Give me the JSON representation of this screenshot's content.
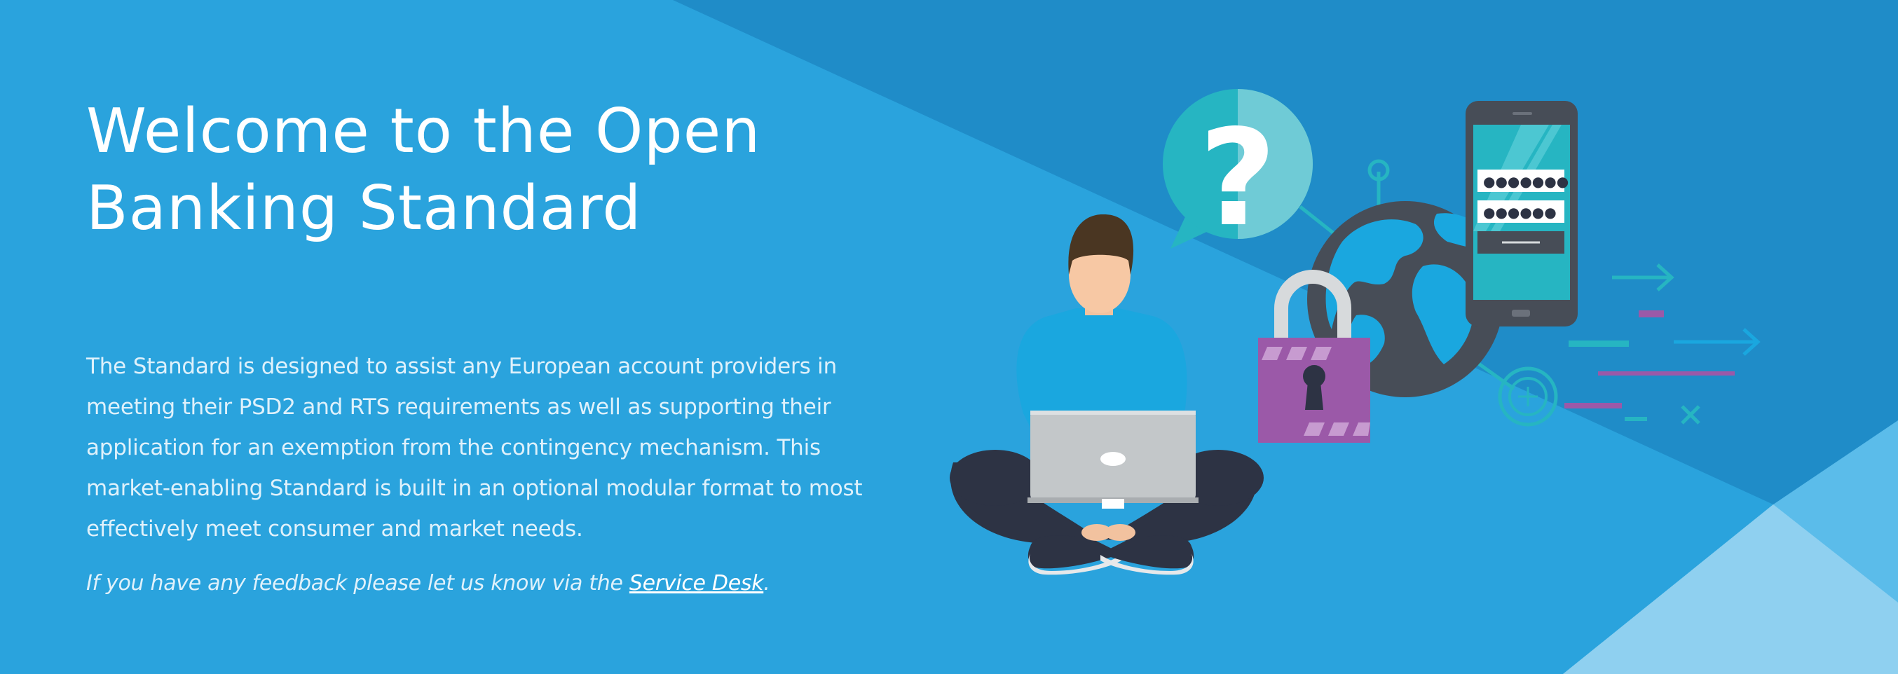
{
  "hero": {
    "title_line1": "Welcome to the Open",
    "title_line2": "Banking Standard",
    "description": "The Standard is designed to assist any European account providers in meeting their PSD2 and RTS requirements as well as supporting their application for an exemption from the contingency mechanism. This market-enabling Standard is built in an optional modular format to most effectively meet consumer and market needs.",
    "feedback_prefix": "If you have any feedback please let us know via the ",
    "feedback_link": "Service Desk",
    "feedback_suffix": "."
  },
  "illustration": {
    "speech_bubble_mark": "?",
    "password_field_1": "●●●●●●●",
    "password_field_2": "●●●●●●"
  },
  "colors": {
    "background": "#2aa3dd",
    "background_dark_band": "#1f8cc8",
    "background_light_corner": "#8fd0f0",
    "accent_teal": "#26b5c2",
    "lock_purple": "#9b59a8",
    "globe_dark": "#474d57"
  },
  "icons": [
    "question-mark-icon",
    "globe-icon",
    "padlock-icon",
    "smartphone-icon",
    "laptop-icon",
    "arrow-right-icon",
    "close-x-icon",
    "plus-circle-icon"
  ]
}
